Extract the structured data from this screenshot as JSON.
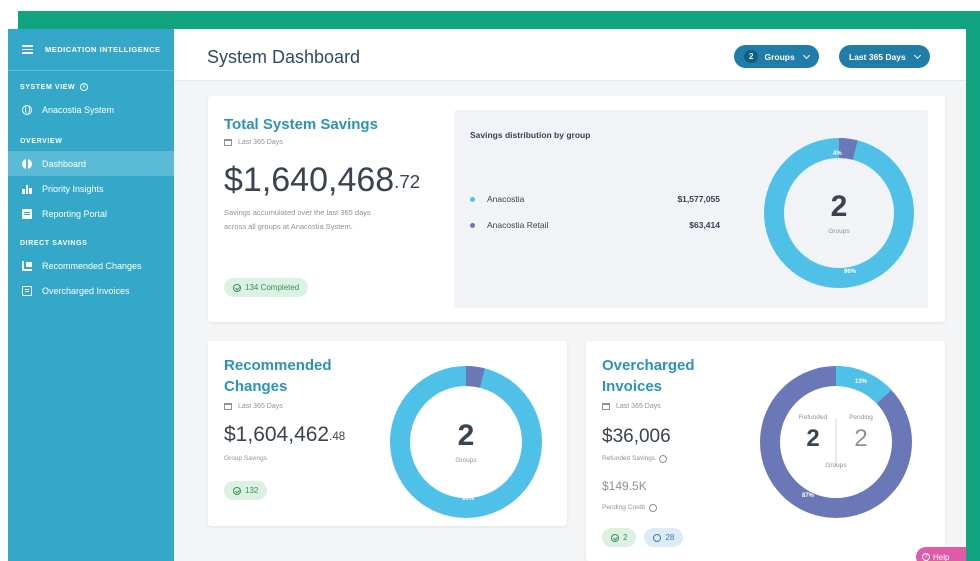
{
  "sidebar": {
    "brand": "MEDICATION INTELLIGENCE",
    "system_view_label": "SYSTEM VIEW",
    "system_name": "Anacostia System",
    "overview_label": "OVERVIEW",
    "overview_items": [
      {
        "label": "Dashboard",
        "icon": "pie-icon",
        "active": true
      },
      {
        "label": "Priority Insights",
        "icon": "bar-chart-icon",
        "active": false
      },
      {
        "label": "Reporting Portal",
        "icon": "report-icon",
        "active": false
      }
    ],
    "direct_savings_label": "DIRECT SAVINGS",
    "direct_items": [
      {
        "label": "Recommended Changes",
        "icon": "changes-icon"
      },
      {
        "label": "Overcharged Invoices",
        "icon": "invoice-icon"
      }
    ]
  },
  "header": {
    "title": "System Dashboard",
    "groups_count": "2",
    "groups_label": "Groups",
    "range_label": "Last 365 Days"
  },
  "total": {
    "title": "Total System Savings",
    "date": "Last 365 Days",
    "amount_main": "$1,640,468",
    "amount_cents": ".72",
    "description": "Savings accumulated over the last 365 days across all groups at Anacostia System.",
    "completed_tag": "134 Completed",
    "distribution_title": "Savings distribution by group",
    "groups": [
      {
        "name": "Anacostia",
        "value": "$1,577,055",
        "color": "#4fc0e8"
      },
      {
        "name": "Anacostia Retail",
        "value": "$63,414",
        "color": "#6b78b8"
      }
    ],
    "donut_number": "2",
    "donut_label": "Groups",
    "pct_large": "96%",
    "pct_small": "4%",
    "share_large": 0.96,
    "share_small": 0.04
  },
  "recommended": {
    "title": "Recommended Changes",
    "date": "Last 365 Days",
    "amount_main": "$1,604,462",
    "amount_cents": ".48",
    "amount_label": "Group Savings",
    "tag": "132",
    "donut_number": "2",
    "donut_label": "Groups",
    "pct_large": "96%",
    "share_large": 0.96,
    "share_small": 0.04
  },
  "overcharged": {
    "title": "Overcharged Invoices",
    "date": "Last 365 Days",
    "refunded_amount": "$36,006",
    "refunded_label": "Refunded Savings",
    "pending_amount": "$149.5K",
    "pending_label": "Pending Credit",
    "tag_done": "2",
    "tag_pending": "28",
    "refunded_head": "Refunded",
    "pending_head": "Pending",
    "refunded_count": "2",
    "pending_count": "2",
    "donut_label": "Groups",
    "pct_small": "13%",
    "pct_large": "87%",
    "share_small": 0.13,
    "share_large": 0.87
  },
  "help_label": "Help",
  "colors": {
    "sidebar": "#35a8c9",
    "accent_title": "#2a94b8",
    "donut_light": "#4fc0e8",
    "donut_dark": "#6b78b8",
    "frame_green": "#0fa37f"
  }
}
